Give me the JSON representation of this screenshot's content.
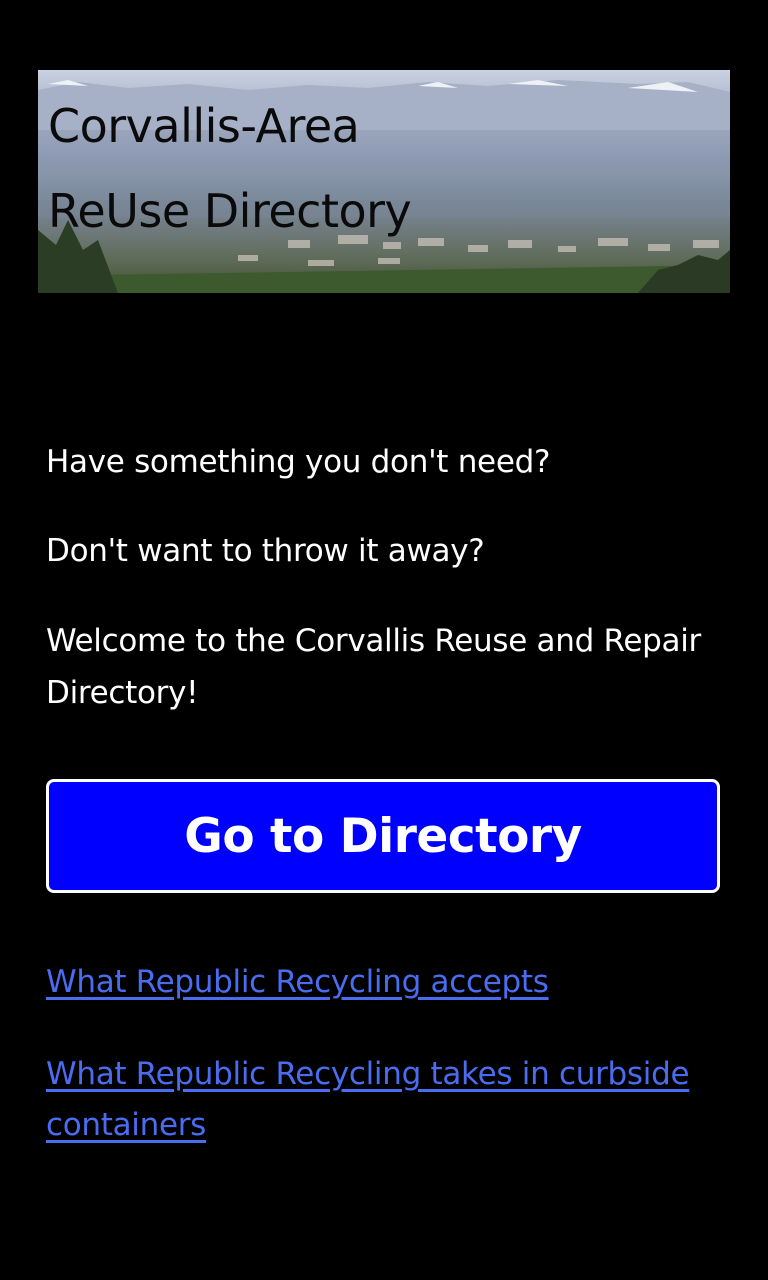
{
  "banner": {
    "title_line1": "Corvallis-Area",
    "title_line2": "ReUse Directory"
  },
  "intro": {
    "line1": "Have something you don't need?",
    "line2": "Don't want to throw it away?",
    "line3": "Welcome to the Corvallis Reuse and Repair Directory!"
  },
  "actions": {
    "go_button_label": "Go to Directory"
  },
  "links": {
    "accepts": "What Republic Recycling accepts",
    "curbside": "What Republic Recycling takes in curbside containers"
  },
  "colors": {
    "background": "#000000",
    "button": "#0000ff",
    "link": "#4a6cf0",
    "text": "#ffffff"
  }
}
